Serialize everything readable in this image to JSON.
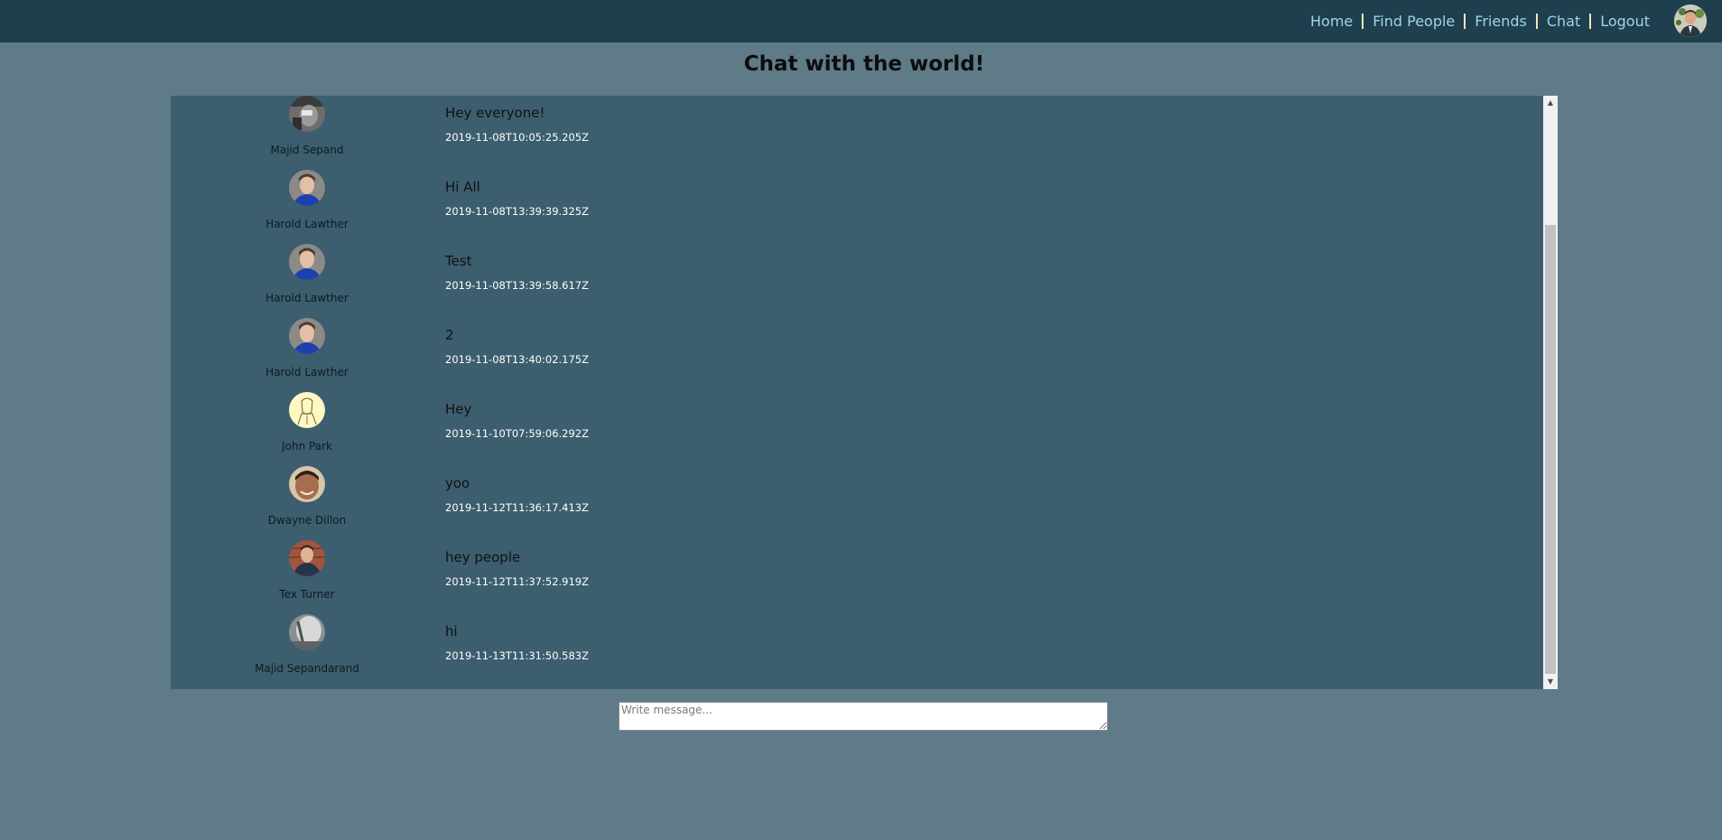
{
  "nav": {
    "home": "Home",
    "find_people": "Find People",
    "friends": "Friends",
    "chat": "Chat",
    "logout": "Logout"
  },
  "page": {
    "title": "Chat with the world!"
  },
  "messages": [
    {
      "name": "Majid Sepand",
      "text": "Hey everyone!",
      "time": "2019-11-08T10:05:25.205Z",
      "avatar": "photo-dark-gray"
    },
    {
      "name": "Harold Lawther",
      "text": "Hi All",
      "time": "2019-11-08T13:39:39.325Z",
      "avatar": "photo-man-blue-shirt"
    },
    {
      "name": "Harold Lawther",
      "text": "Test",
      "time": "2019-11-08T13:39:58.617Z",
      "avatar": "photo-man-blue-shirt"
    },
    {
      "name": "Harold Lawther",
      "text": "2",
      "time": "2019-11-08T13:40:02.175Z",
      "avatar": "photo-man-blue-shirt"
    },
    {
      "name": "John Park",
      "text": "Hey",
      "time": "2019-11-10T07:59:06.292Z",
      "avatar": "sketch-yellow"
    },
    {
      "name": "Dwayne Dillon",
      "text": "yoo",
      "time": "2019-11-12T11:36:17.413Z",
      "avatar": "photo-smiling-man"
    },
    {
      "name": "Tex Turner",
      "text": "hey people",
      "time": "2019-11-12T11:37:52.919Z",
      "avatar": "photo-man-brick-wall"
    },
    {
      "name": "Majid Sepandarand",
      "text": "hi",
      "time": "2019-11-13T11:31:50.583Z",
      "avatar": "photo-light-gray"
    }
  ],
  "composer": {
    "placeholder": "Write message..."
  },
  "colors": {
    "topbar": "#1f3f4f",
    "background": "#5f7b88",
    "chat_panel": "#3c5e6f",
    "nav_link": "#9fd3ea",
    "nav_separator": "#f2e7b6"
  }
}
